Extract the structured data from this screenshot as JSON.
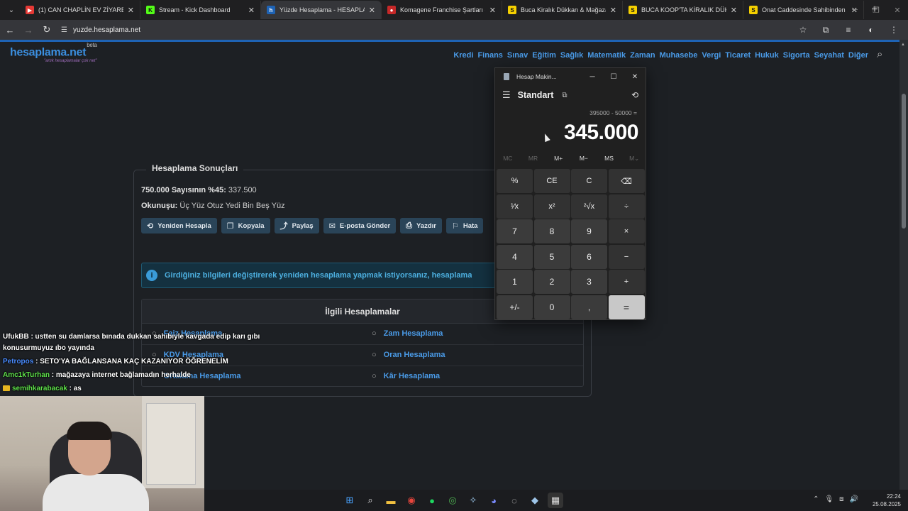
{
  "browser": {
    "tabs": [
      {
        "title": "(1) CAN CHAPLİN EV ZİYARETİ",
        "favicon_color": "#e53935",
        "favicon_glyph": "▶"
      },
      {
        "title": "Stream - Kick Dashboard",
        "favicon_color": "#53fc18",
        "favicon_glyph": "K"
      },
      {
        "title": "Yüzde Hesaplama - HESAPLAM",
        "favicon_color": "#1e63b5",
        "favicon_glyph": "h",
        "active": true
      },
      {
        "title": "Komagene Franchise Şartları - ",
        "favicon_color": "#c62828",
        "favicon_glyph": "●"
      },
      {
        "title": "Buca Kiralık Dükkan & Mağaza",
        "favicon_color": "#f5d000",
        "favicon_glyph": "S"
      },
      {
        "title": "BUCA KOOP'TA KİRALIK DÜKKA",
        "favicon_color": "#f5d000",
        "favicon_glyph": "S"
      },
      {
        "title": "Onat Caddesinde Sahibinden K",
        "favicon_color": "#f5d000",
        "favicon_glyph": "S"
      }
    ],
    "url": "yuzde.hesaplama.net"
  },
  "site": {
    "logo": "hesaplama.net",
    "logo_sup": "beta",
    "tagline": "\"artık hesaplamalar çok net\"",
    "menu": [
      "Kredi",
      "Finans",
      "Sınav",
      "Eğitim",
      "Sağlık",
      "Matematik",
      "Zaman",
      "Muhasebe",
      "Vergi",
      "Ticaret",
      "Hukuk",
      "Sigorta",
      "Seyahat",
      "Diğer"
    ],
    "results": {
      "title": "Hesaplama Sonuçları",
      "line1_label": "750.000 Sayısının %45:",
      "line1_value": " 337.500",
      "line2_label": "Okunuşu:",
      "line2_value": " Üç Yüz Otuz Yedi Bin Beş Yüz"
    },
    "actions": [
      {
        "label": "Yeniden Hesapla",
        "icon": "⟲"
      },
      {
        "label": "Kopyala",
        "icon": "❐"
      },
      {
        "label": "Paylaş",
        "icon": "⤴"
      },
      {
        "label": "E-posta Gönder",
        "icon": "✉"
      },
      {
        "label": "Yazdır",
        "icon": "⎙"
      },
      {
        "label": "Hata",
        "icon": "⚐"
      }
    ],
    "info": "Girdiğiniz bilgileri değiştirerek yeniden hesaplama yapmak istiyorsanız, hesaplama",
    "related": {
      "title": "İlgili Hesaplamalar",
      "left": [
        "Faiz Hesaplama",
        "KDV Hesaplama",
        "Ortalama Hesaplama"
      ],
      "right": [
        "Zam Hesaplama",
        "Oran Hesaplama",
        "Kâr Hesaplama"
      ]
    }
  },
  "calculator": {
    "window_title": "Hesap Makin...",
    "mode": "Standart",
    "expression": "395000 - 50000 =",
    "display": "345.000",
    "memory": [
      "MC",
      "MR",
      "M+",
      "M−",
      "MS",
      "M⌄"
    ],
    "keys": [
      "%",
      "CE",
      "C",
      "⌫",
      "¹⁄x",
      "x²",
      "²√x",
      "÷",
      "7",
      "8",
      "9",
      "×",
      "4",
      "5",
      "6",
      "−",
      "1",
      "2",
      "3",
      "+",
      "+/-",
      "0",
      ",",
      "="
    ]
  },
  "chat": [
    {
      "user": "UfukBB",
      "color": "#ffffff",
      "text": " : ustten su damlarsa bınada dukkan sahıbıyle kavgada edip karı gıbı"
    },
    {
      "user": "",
      "color": "#ffffff",
      "text": "konusurmuyuz ıbo yayında"
    },
    {
      "user": "Petropos",
      "color": "#4a8cff",
      "text": " : SETO'YA BAĞLANSANA KAÇ KAZANIYOR ÖĞRENELİM"
    },
    {
      "user": "Amc1kTurhan",
      "color": "#5ee04a",
      "text": " : mağazaya internet bağlamadın herhalde"
    },
    {
      "user": "semihkarabacak",
      "color": "#5ee04a",
      "text": " : as",
      "badge": true
    }
  ],
  "taskbar": {
    "time": "22:24",
    "date": "25.08.2025"
  }
}
